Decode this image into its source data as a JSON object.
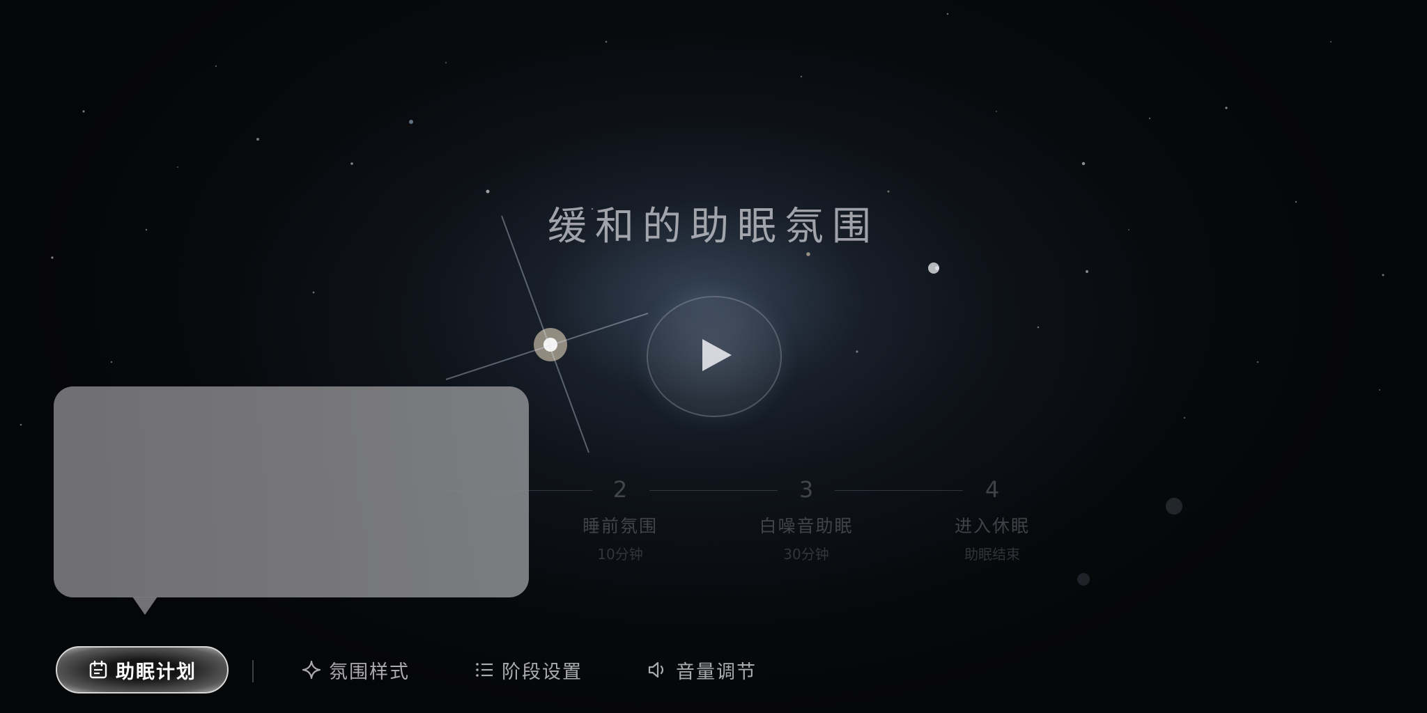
{
  "title": "缓和的助眠氛围",
  "play": {
    "icon": "play-icon"
  },
  "steps": [
    {
      "number": "2",
      "name": "睡前氛围",
      "duration": "10分钟"
    },
    {
      "number": "3",
      "name": "白噪音助眠",
      "duration": "30分钟"
    },
    {
      "number": "4",
      "name": "进入休眠",
      "duration": "助眠结束"
    }
  ],
  "toolbar": {
    "plan": {
      "label": "助眠计划",
      "icon": "calendar-icon"
    },
    "atmosphere": {
      "label": "氛围样式",
      "icon": "sparkle-icon"
    },
    "stages": {
      "label": "阶段设置",
      "icon": "list-icon"
    },
    "volume": {
      "label": "音量调节",
      "icon": "speaker-icon"
    }
  },
  "colors": {
    "tooltip": "#7c7c7e",
    "text_primary": "#ffffff",
    "text_muted": "#6e7076"
  }
}
